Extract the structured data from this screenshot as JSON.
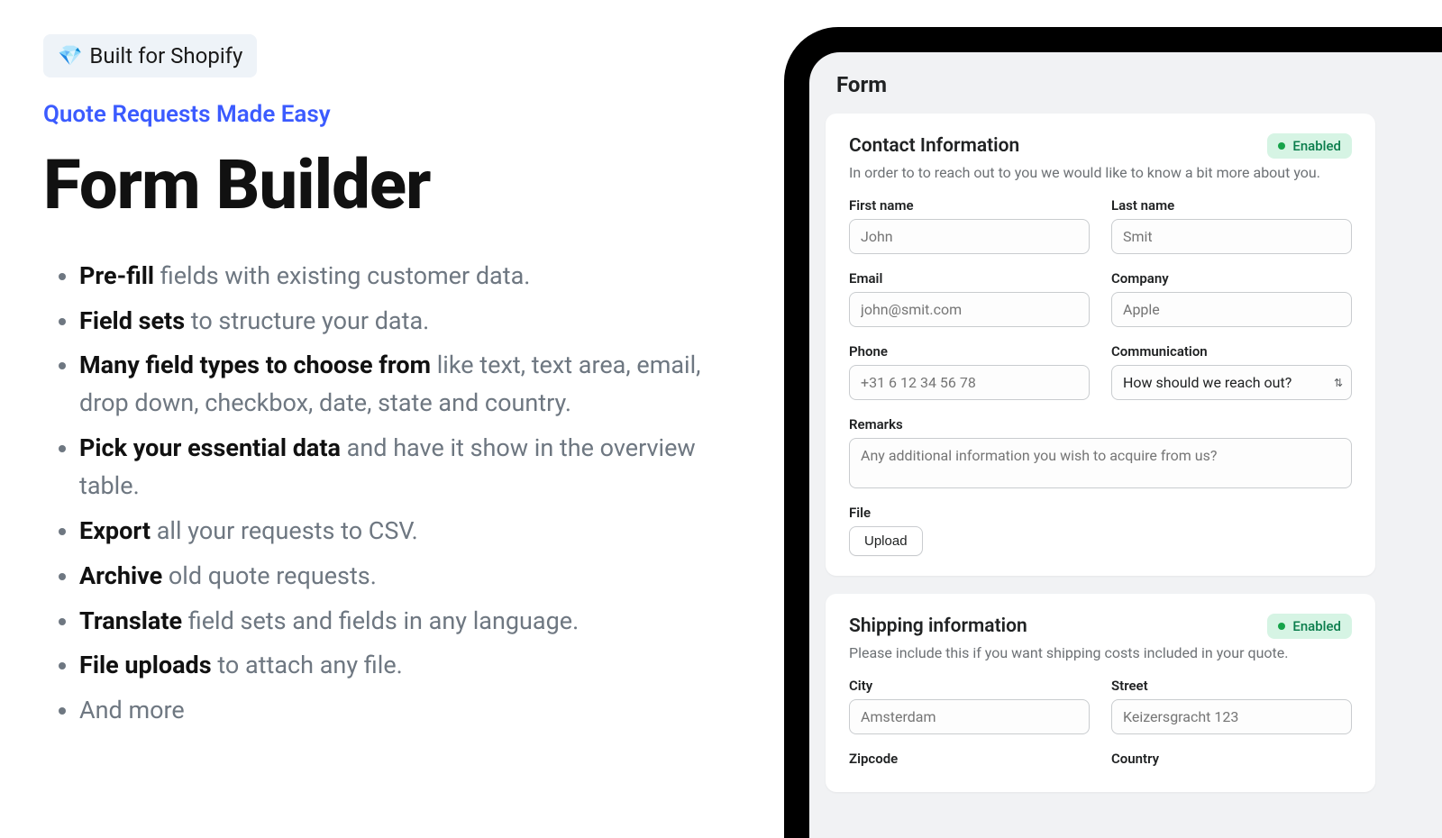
{
  "left": {
    "badge_icon": "💎",
    "badge_text": "Built for Shopify",
    "tagline": "Quote Requests Made Easy",
    "heading": "Form Builder",
    "features": [
      {
        "bold": "Pre-fill",
        "rest": " fields with existing customer data."
      },
      {
        "bold": "Field sets",
        "rest": " to structure your data."
      },
      {
        "bold": "Many field types to choose from",
        "rest": " like text, text area, email, drop down, checkbox, date, state and country."
      },
      {
        "bold": "Pick your essential data",
        "rest": " and have it show in the overview table."
      },
      {
        "bold": "Export",
        "rest": " all your requests to CSV."
      },
      {
        "bold": "Archive",
        "rest": " old quote requests."
      },
      {
        "bold": "Translate",
        "rest": " field sets and fields in any language."
      },
      {
        "bold": "File uploads",
        "rest": " to attach any file."
      },
      {
        "bold": "",
        "rest": "And more"
      }
    ]
  },
  "screen": {
    "title": "Form",
    "sections": {
      "contact": {
        "title": "Contact Information",
        "status": "Enabled",
        "desc": "In order to to reach out to you we would like to know a bit more about you.",
        "fields": {
          "first_name": {
            "label": "First name",
            "placeholder": "John"
          },
          "last_name": {
            "label": "Last name",
            "placeholder": "Smit"
          },
          "email": {
            "label": "Email",
            "placeholder": "john@smit.com"
          },
          "company": {
            "label": "Company",
            "placeholder": "Apple"
          },
          "phone": {
            "label": "Phone",
            "placeholder": "+31 6 12 34 56 78"
          },
          "communication": {
            "label": "Communication",
            "value": "How should we reach out?"
          },
          "remarks": {
            "label": "Remarks",
            "placeholder": "Any additional information you wish to acquire from us?"
          },
          "file": {
            "label": "File",
            "button": "Upload"
          }
        }
      },
      "shipping": {
        "title": "Shipping information",
        "status": "Enabled",
        "desc": "Please include this if you want shipping costs included in your quote.",
        "fields": {
          "city": {
            "label": "City",
            "placeholder": "Amsterdam"
          },
          "street": {
            "label": "Street",
            "placeholder": "Keizersgracht 123"
          },
          "zipcode": {
            "label": "Zipcode"
          },
          "country": {
            "label": "Country"
          }
        }
      }
    }
  }
}
